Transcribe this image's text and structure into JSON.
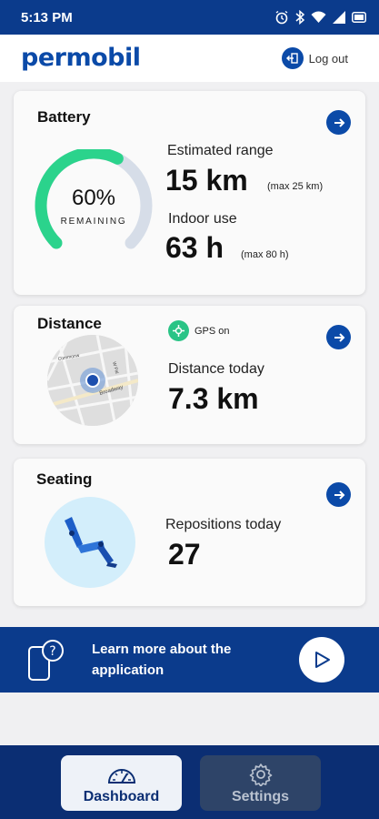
{
  "status": {
    "time": "5:13 PM"
  },
  "header": {
    "logo": "permobil",
    "logout_label": "Log out"
  },
  "battery": {
    "title": "Battery",
    "percent_label": "60%",
    "percent_value": 60,
    "remaining_label": "REMAINING",
    "range_label": "Estimated range",
    "range_value": "15 km",
    "range_max": "(max 25 km)",
    "indoor_label": "Indoor use",
    "indoor_value": "63 h",
    "indoor_max": "(max 80 h)",
    "gauge_color": "#2bd38c",
    "gauge_track_color": "#d6dde8"
  },
  "distance": {
    "title": "Distance",
    "gps_label": "GPS on",
    "today_label": "Distance today",
    "today_value": "7.3 km",
    "map_streets": [
      "Broadway",
      "Commonw",
      "W Pal"
    ]
  },
  "seating": {
    "title": "Seating",
    "repositions_label": "Repositions today",
    "repositions_value": "27"
  },
  "banner": {
    "text": "Learn more about the application"
  },
  "nav": {
    "dashboard_label": "Dashboard",
    "settings_label": "Settings"
  },
  "colors": {
    "brand": "#0b4aa8",
    "header": "#0b3b8c",
    "nav": "#0b2e73",
    "gps": "#2ac486"
  }
}
